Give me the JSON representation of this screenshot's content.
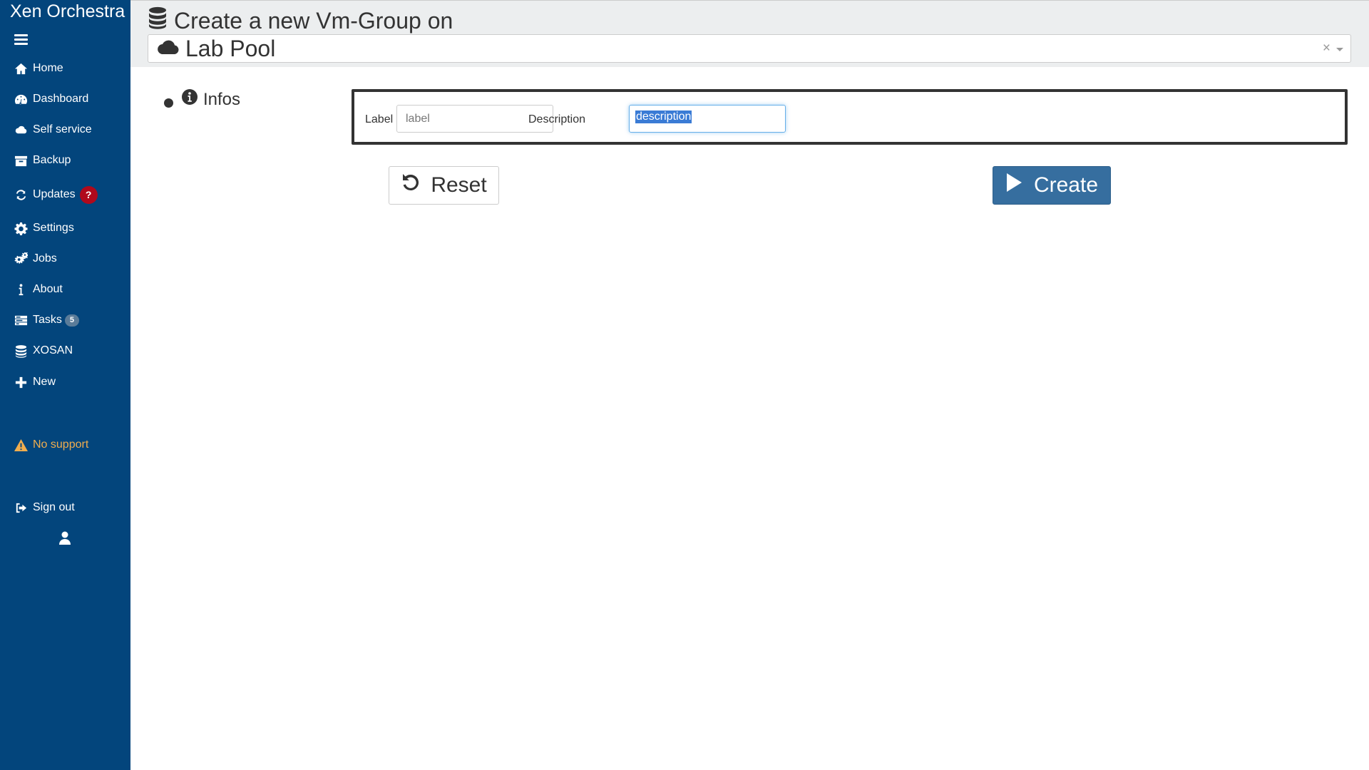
{
  "app": {
    "brand": "Xen Orchestra"
  },
  "sidebar": {
    "items": [
      {
        "label": "Home",
        "icon": "home-icon"
      },
      {
        "label": "Dashboard",
        "icon": "dashboard-icon"
      },
      {
        "label": "Self service",
        "icon": "cloud-icon"
      },
      {
        "label": "Backup",
        "icon": "archive-icon"
      },
      {
        "label": "Updates",
        "icon": "refresh-icon",
        "badge": "?"
      },
      {
        "label": "Settings",
        "icon": "gear-icon"
      },
      {
        "label": "Jobs",
        "icon": "gears-icon"
      },
      {
        "label": "About",
        "icon": "info-icon"
      },
      {
        "label": "Tasks",
        "icon": "tasks-icon",
        "badge": "5"
      },
      {
        "label": "XOSAN",
        "icon": "database-icon"
      },
      {
        "label": "New",
        "icon": "plus-icon"
      }
    ],
    "warning": {
      "label": "No support",
      "icon": "warning-icon",
      "color": "#f0ad4e"
    },
    "signout": {
      "label": "Sign out",
      "icon": "sign-out-icon"
    },
    "colors": {
      "background": "#03457c",
      "badge_red": "#b0091c"
    }
  },
  "header": {
    "title": "Create a new Vm-Group on",
    "pool_select": {
      "value": "Lab Pool",
      "clear": "×"
    }
  },
  "section": {
    "title": "Infos"
  },
  "form": {
    "label": {
      "label": "Label",
      "placeholder": "label",
      "value": ""
    },
    "description": {
      "label": "Description",
      "placeholder": "description",
      "value": ""
    }
  },
  "buttons": {
    "reset": "Reset",
    "create": "Create",
    "create_color": "#366e9f"
  }
}
